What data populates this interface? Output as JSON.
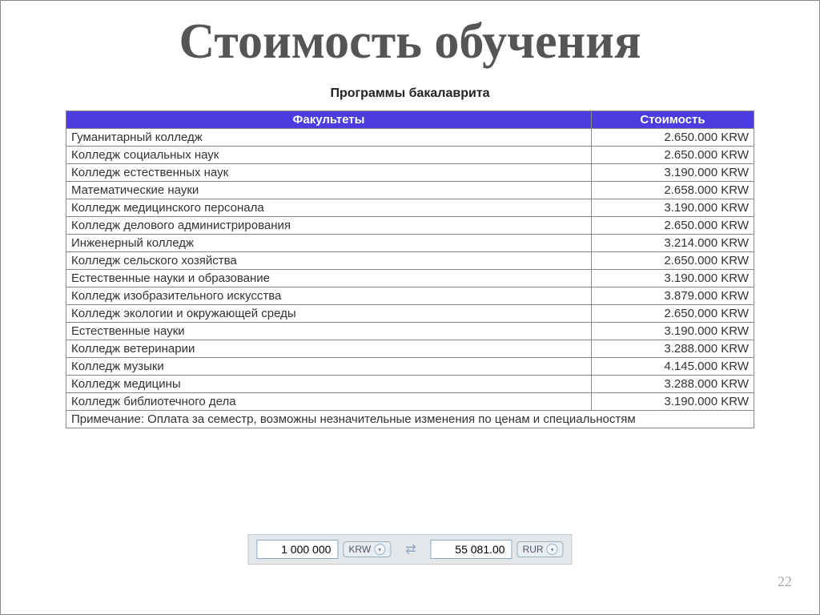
{
  "title": "Стоимость обучения",
  "subtitle": "Программы бакалаврита",
  "headers": {
    "faculty": "Факультеты",
    "cost": "Стоимость"
  },
  "rows": [
    {
      "faculty": "Гуманитарный колледж",
      "cost": "2.650.000 KRW"
    },
    {
      "faculty": "Колледж социальных наук",
      "cost": "2.650.000 KRW"
    },
    {
      "faculty": "Колледж естественных наук",
      "cost": "3.190.000 KRW"
    },
    {
      "faculty": "Математические науки",
      "cost": "2.658.000 KRW"
    },
    {
      "faculty": "Колледж медицинского персонала",
      "cost": "3.190.000 KRW"
    },
    {
      "faculty": "Колледж делового администрирования",
      "cost": "2.650.000 KRW"
    },
    {
      "faculty": "Инженерный колледж",
      "cost": "3.214.000 KRW"
    },
    {
      "faculty": "Колледж сельского хозяйства",
      "cost": "2.650.000 KRW"
    },
    {
      "faculty": "Естественные науки и образование",
      "cost": "3.190.000 KRW"
    },
    {
      "faculty": "Колледж изобразительного искусства",
      "cost": "3.879.000 KRW"
    },
    {
      "faculty": "Колледж экологии и окружающей среды",
      "cost": "2.650.000 KRW"
    },
    {
      "faculty": "Естественные науки",
      "cost": "3.190.000 KRW"
    },
    {
      "faculty": "Колледж ветеринарии",
      "cost": "3.288.000 KRW"
    },
    {
      "faculty": "Колледж музыки",
      "cost": "4.145.000 KRW"
    },
    {
      "faculty": "Колледж медицины",
      "cost": "3.288.000 KRW"
    },
    {
      "faculty": "Колледж библиотечного дела",
      "cost": "3.190.000 KRW"
    }
  ],
  "note": "Примечание: Оплата за семестр, возможны незначительные изменения по ценам и специальностям",
  "converter": {
    "from_value": "1 000 000",
    "from_cur": "KRW",
    "to_value": "55 081.00",
    "to_cur": "RUR"
  },
  "page_number": "22"
}
